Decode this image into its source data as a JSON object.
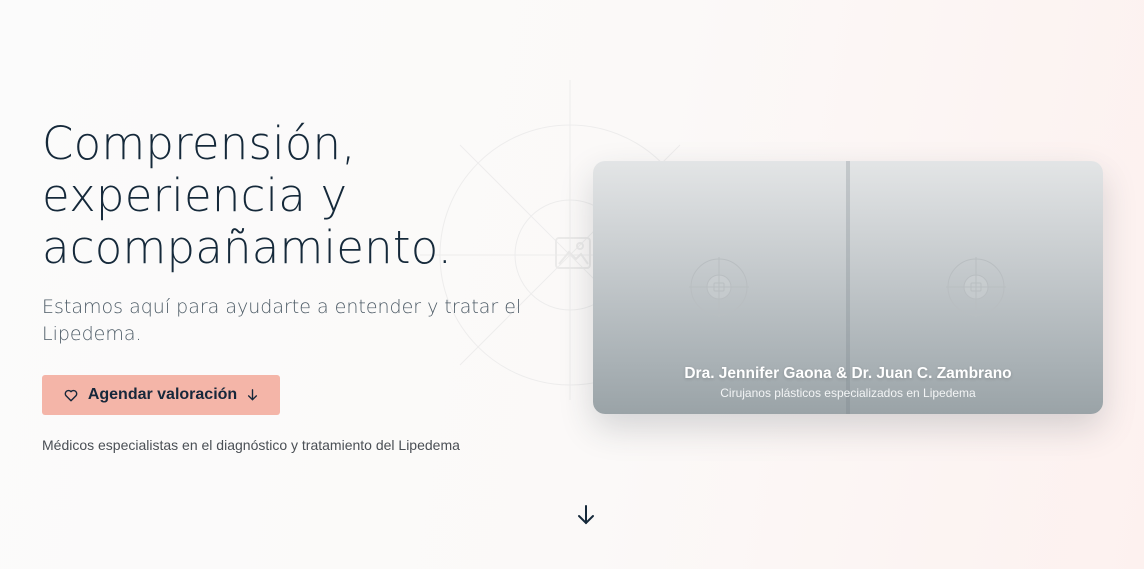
{
  "hero": {
    "title_line1": "Comprensión,",
    "title_line2": "experiencia y",
    "title_line3": "acompañamiento.",
    "subtitle": "Estamos aquí para ayudarte a entender y tratar el Lipedema.",
    "cta_label": "Agendar valoración",
    "cta_icon": "heart-icon",
    "cta_trailing_icon": "arrow-down-icon",
    "tagline": "Médicos especialistas en el diagnóstico y tratamiento del Lipedema"
  },
  "card": {
    "names": "Dra. Jennifer Gaona & Dr. Juan C. Zambrano",
    "role": "Cirujanos plásticos especializados en Lipedema",
    "placeholder_icon": "image-placeholder-icon"
  },
  "scroll": {
    "icon": "arrow-down-icon"
  },
  "colors": {
    "accent": "#f4b5a8",
    "text_dark": "#15293a",
    "text_muted": "#4d5b66",
    "background": "#fbf9f8"
  }
}
